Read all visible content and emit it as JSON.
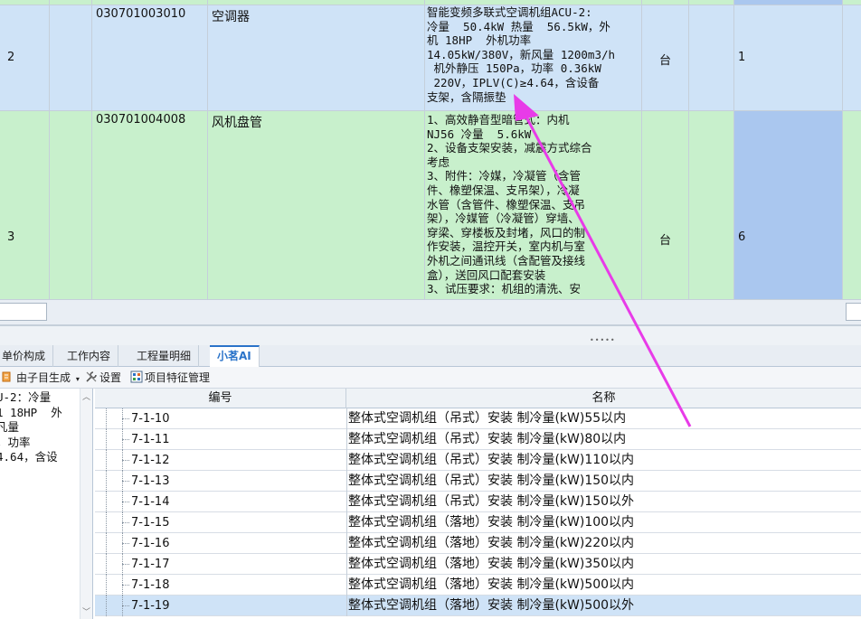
{
  "upper_table": {
    "row2": {
      "index": "2",
      "code": "030701003010",
      "name": "空调器",
      "desc": "智能变频多联式空调机组ACU-2:\n冷量  50.4kW 热量  56.5kW，外\n机 18HP  外机功率\n14.05kW/380V，新风量 1200m3/h\n 机外静压 150Pa，功率 0.36kW\n 220V，IPLV(C)≥4.64，含设备\n支架，含隔振垫",
      "unit": "台",
      "qty": "1"
    },
    "row3": {
      "index": "3",
      "code": "030701004008",
      "name": "风机盘管",
      "desc": "1、高效静音型暗管式：内机\nNJ56 冷量  5.6kW\n2、设备支架安装，减震方式综合\n考虑\n3、附件：冷媒，冷凝管（含管\n件、橡塑保温、支吊架），冷凝\n水管（含管件、橡塑保温、支吊\n架），冷媒管（冷凝管）穿墙、\n穿梁、穿楼板及封堵，风口的制\n作安装，温控开关，室内机与室\n外机之间通讯线（含配管及接线\n盒），送回风口配套安装\n3、试压要求：机组的清洗、安",
      "unit": "台",
      "qty": "6"
    }
  },
  "tabs": [
    "单价构成",
    "工作内容",
    "工程量明细",
    "小茗AI"
  ],
  "toolbar": {
    "generate_label": "由子目生成",
    "settings_label": "设置",
    "feature_label": "项目特征管理"
  },
  "left_panel_text": "U-2：冷量\n1 18HP  外\n凡量\n，功率\n4.64，含设",
  "lower_table": {
    "headers": [
      "编号",
      "名称"
    ],
    "rows": [
      {
        "code": "7-1-10",
        "name": "整体式空调机组（吊式）安装 制冷量(kW)55以内"
      },
      {
        "code": "7-1-11",
        "name": "整体式空调机组（吊式）安装 制冷量(kW)80以内"
      },
      {
        "code": "7-1-12",
        "name": "整体式空调机组（吊式）安装 制冷量(kW)110以内"
      },
      {
        "code": "7-1-13",
        "name": "整体式空调机组（吊式）安装 制冷量(kW)150以内"
      },
      {
        "code": "7-1-14",
        "name": "整体式空调机组（吊式）安装 制冷量(kW)150以外"
      },
      {
        "code": "7-1-15",
        "name": "整体式空调机组（落地）安装 制冷量(kW)100以内"
      },
      {
        "code": "7-1-16",
        "name": "整体式空调机组（落地）安装 制冷量(kW)220以内"
      },
      {
        "code": "7-1-17",
        "name": "整体式空调机组（落地）安装 制冷量(kW)350以内"
      },
      {
        "code": "7-1-18",
        "name": "整体式空调机组（落地）安装 制冷量(kW)500以内"
      },
      {
        "code": "7-1-19",
        "name": "整体式空调机组（落地）安装 制冷量(kW)500以外"
      }
    ]
  },
  "colors": {
    "row_blue": "#cfe3f7",
    "row_green": "#c8f0cc",
    "qty_highlight": "#aac7ef",
    "active_tab": "#2a73c9",
    "annotation_arrow": "#e83be8"
  }
}
